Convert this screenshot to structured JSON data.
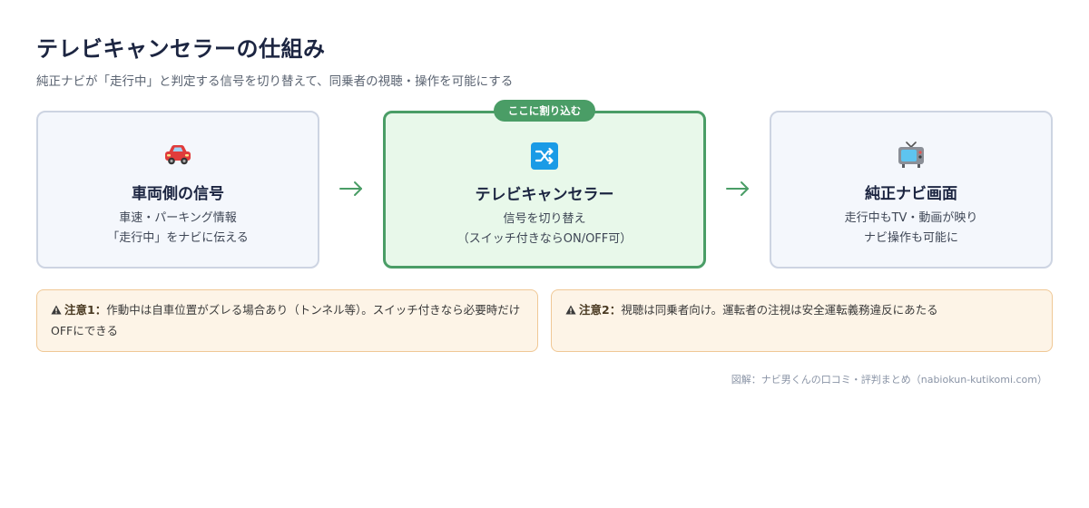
{
  "header": {
    "title": "テレビキャンセラーの仕組み",
    "subtitle": "純正ナビが「走行中」と判定する信号を切り替えて、同乗者の視聴・操作を可能にする"
  },
  "flow": {
    "badge": "ここに割り込む",
    "arrow_glyph": "→",
    "boxes": [
      {
        "icon": "car-icon",
        "title": "車両側の信号",
        "desc": [
          "車速・パーキング情報",
          "「走行中」をナビに伝える"
        ]
      },
      {
        "icon": "shuffle-icon",
        "title": "テレビキャンセラー",
        "desc": [
          "信号を切り替え",
          "（スイッチ付きならON/OFF可）"
        ]
      },
      {
        "icon": "tv-icon",
        "title": "純正ナビ画面",
        "desc": [
          "走行中もTV・動画が映り",
          "ナビ操作も可能に"
        ]
      }
    ]
  },
  "notes": [
    {
      "icon": "warning-icon",
      "label": "注意1：",
      "text": "作動中は自車位置がズレる場合あり（トンネル等）。スイッチ付きなら必要時だけOFFにできる"
    },
    {
      "icon": "warning-icon",
      "label": "注意2：",
      "text": "視聴は同乗者向け。運転者の注視は安全運転義務違反にあたる"
    }
  ],
  "footer": {
    "credit": "図解：ナビ男くんの口コミ・評判まとめ（nabiokun-kutikomi.com）"
  },
  "colors": {
    "accent_green": "#4a9d66",
    "center_fill": "#e8f8ea",
    "side_fill": "#f4f7fc",
    "note_fill": "#fdf4e7",
    "note_border": "#f0c896"
  }
}
